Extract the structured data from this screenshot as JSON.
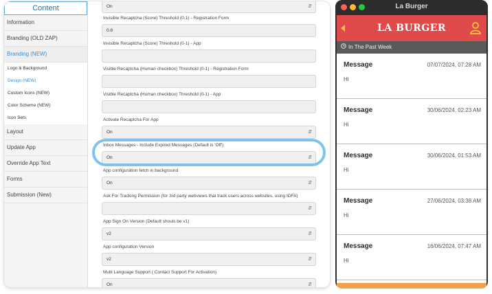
{
  "admin": {
    "sidebar_title": "Content",
    "nav_items": [
      {
        "label": "Information"
      },
      {
        "label": "Branding (OLD ZAP)"
      },
      {
        "label": "Branding (NEW)"
      }
    ],
    "sub_items": [
      {
        "label": "Logo & Background"
      },
      {
        "label": "Design (NEW)"
      },
      {
        "label": "Custom Icons (NEW)"
      },
      {
        "label": "Color Scheme (NEW)"
      },
      {
        "label": "Icon Sets"
      }
    ],
    "nav_items_bottom": [
      {
        "label": "Layout"
      },
      {
        "label": "Update App"
      },
      {
        "label": "Override App Text"
      },
      {
        "label": "Forms"
      },
      {
        "label": "Submission (New)"
      }
    ],
    "fields": [
      {
        "label": "",
        "value": "On",
        "dropdown": true
      },
      {
        "label": "Invisible Recaptcha (Score) Threshold (0-1) - Registration Form",
        "value": "0.8",
        "dropdown": false
      },
      {
        "label": "Invisible Recaptcha (Score) Threshold (0-1) - App",
        "value": "",
        "dropdown": false
      },
      {
        "label": "Visible Recaptcha (Human checkbox) Threshold (0-1) - Registration Form",
        "value": "",
        "dropdown": false
      },
      {
        "label": "Visible Recaptcha (Human checkbox) Threshold (0-1) - App",
        "value": "",
        "dropdown": false
      },
      {
        "label": "Activate Recaptcha For App",
        "value": "On",
        "dropdown": true
      },
      {
        "label": "Inbox Messages - Include Expired Messages (Default is 'Off')",
        "value": "On",
        "dropdown": true
      },
      {
        "label": "App configuration fetch in background",
        "value": "On",
        "dropdown": true
      },
      {
        "label": "Ask For Tracking Permission (for 3rd party webviews that track users across websites, using IDFA)",
        "value": "",
        "dropdown": true
      },
      {
        "label": "App Sign On Version (Default shouls be v1)",
        "value": "v2",
        "dropdown": true
      },
      {
        "label": "App configuration Version",
        "value": "v2",
        "dropdown": true
      },
      {
        "label": "Multi Language Support ( Contact Support For Activation)",
        "value": "On",
        "dropdown": true
      }
    ]
  },
  "phone": {
    "window_title": "La Burger",
    "brand": "LA BURGER",
    "filter": "In The Past Week",
    "messages": [
      {
        "title": "Message",
        "date": "07/07/2024, 07:28 AM",
        "body": "Hi"
      },
      {
        "title": "Message",
        "date": "30/06/2024, 02:23 AM",
        "body": "Hi"
      },
      {
        "title": "Message",
        "date": "30/06/2024, 01:53 AM",
        "body": "Hi"
      },
      {
        "title": "Message",
        "date": "27/06/2024, 03:38 AM",
        "body": "Hi"
      },
      {
        "title": "Message",
        "date": "16/06/2024, 07:47 AM",
        "body": "Hi"
      }
    ]
  },
  "colors": {
    "header_red": "#e04a4a",
    "accent_yellow": "#f6c43a",
    "filter_gray": "#5a5a5a",
    "divider_orange": "#e8b27a",
    "admin_blue": "#3b8ed3",
    "highlight_ring": "#7dc3ee"
  },
  "icons": {
    "back": "back-arrow-icon",
    "user": "user-icon",
    "clock": "clock-icon",
    "dropdown": "chevron-updown-icon"
  }
}
